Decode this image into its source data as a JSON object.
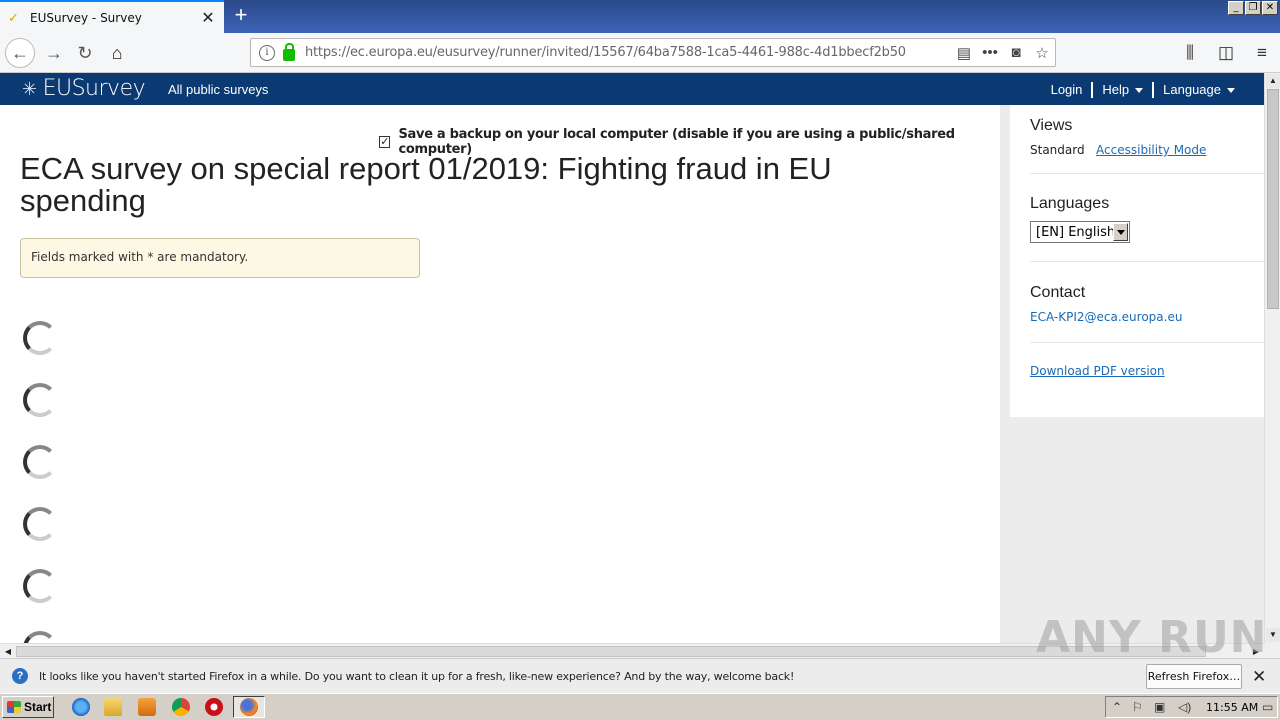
{
  "browser": {
    "tab_title": "EUSurvey - Survey",
    "new_tab": "+",
    "url": "https://ec.europa.eu/eusurvey/runner/invited/15567/64ba7588-1ca5-4461-988c-4d1bbecf2b50",
    "window_controls": [
      "_",
      "❐",
      "✕"
    ]
  },
  "header": {
    "logo": "EUSurvey",
    "all_public": "All public surveys",
    "nav": {
      "login": "Login",
      "help": "Help",
      "language": "Language"
    }
  },
  "main": {
    "backup_label": "Save a backup on your local computer (disable if you are using a public/shared computer)",
    "backup_checked": true,
    "title": "ECA survey on special report 01/2019: Fighting fraud in EU spending",
    "mandatory_note": "Fields marked with * are mandatory.",
    "loading_spinners": 6
  },
  "sidebar": {
    "views_heading": "Views",
    "views_standard": "Standard",
    "views_accessibility": "Accessibility Mode",
    "languages_heading": "Languages",
    "language_selected": "[EN] English",
    "contact_heading": "Contact",
    "contact_email": "ECA-KPI2@eca.europa.eu",
    "download_pdf": "Download PDF version"
  },
  "notification": {
    "message": "It looks like you haven't started Firefox in a while. Do you want to clean it up for a fresh, like-new experience? And by the way, welcome back!",
    "button": "Refresh Firefox…"
  },
  "taskbar": {
    "start": "Start",
    "clock": "11:55 AM"
  },
  "watermark": "ANY RUN",
  "colors": {
    "header_bg": "#0b3a73",
    "link": "#1a6ab5",
    "note_bg": "#fcf8e3",
    "lock_green": "#12bc00"
  }
}
